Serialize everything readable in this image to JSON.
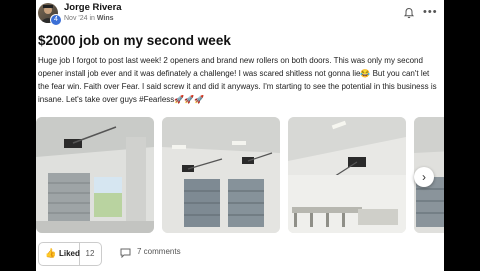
{
  "post": {
    "author": "Jorge Rivera",
    "date": "Nov '24",
    "in_text": "in",
    "category": "Wins",
    "title": "$2000 job on my second week",
    "body": "Huge job I forgot to post last week! 2 openers and brand new rollers on both doors. This was only my second opener install job ever and it was definately a challenge! I was scared shitless not gonna lie😂 But you can't let the fear win. Faith over Fear. I said screw it and did it anyways. I'm starting to see the potential in this business is insane. Let's take over guys #Fearless🚀🚀🚀"
  },
  "photos": [
    {
      "alt": "garage-photo-1"
    },
    {
      "alt": "garage-photo-2"
    },
    {
      "alt": "garage-photo-3"
    },
    {
      "alt": "garage-photo-4"
    }
  ],
  "actions": {
    "liked_label": "Liked",
    "like_count": "12",
    "comments_label": "7 comments"
  },
  "icons": {
    "avatar_badge": "4",
    "next": "›",
    "more": "•••",
    "thumb": "👍"
  },
  "colors": {
    "badge": "#3b6fd6",
    "category_dot": "#a36bd8"
  }
}
